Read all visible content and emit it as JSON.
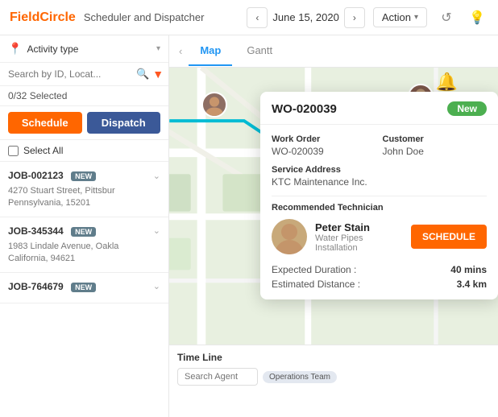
{
  "header": {
    "logo_brand": "Field",
    "logo_accent": "Circle",
    "title": "Scheduler and Dispatcher",
    "date": "June 15, 2020",
    "action_label": "Action",
    "refresh_icon": "↺",
    "bulb_icon": "💡"
  },
  "sidebar": {
    "activity_type_label": "Activity type",
    "search_placeholder": "Search by ID, Locat...",
    "selected_count": "0/32 Selected",
    "schedule_btn": "Schedule",
    "dispatch_btn": "Dispatch",
    "select_all_label": "Select All",
    "jobs": [
      {
        "id": "JOB-002123",
        "badge": "NEW",
        "address": "4270 Stuart Street, Pittsbur",
        "state": "Pennsylvania, 15201"
      },
      {
        "id": "JOB-345344",
        "badge": "NEW",
        "address": "1983 Lindale Avenue, Oakla",
        "state": "California, 94621"
      },
      {
        "id": "JOB-764679",
        "badge": "NEW",
        "address": "",
        "state": ""
      }
    ]
  },
  "tabs": [
    {
      "label": "Map",
      "active": true
    },
    {
      "label": "Gantt",
      "active": false
    }
  ],
  "timeline": {
    "title": "Time Line",
    "search_placeholder": "Search Agent",
    "ops_tag": "Operations Team"
  },
  "popup": {
    "wo_id": "WO-020039",
    "badge": "New",
    "work_order_label": "Work Order",
    "work_order_value": "WO-020039",
    "customer_label": "Customer",
    "customer_value": "John Doe",
    "service_address_label": "Service Address",
    "service_address_value": "KTC Maintenance Inc.",
    "rec_tech_label": "Recommended Technician",
    "tech_name": "Peter Stain",
    "tech_role": "Water Pipes Installation",
    "schedule_btn": "SCHEDULE",
    "expected_duration_label": "Expected Duration :",
    "expected_duration_value": "40 mins",
    "estimated_distance_label": "Estimated Distance :",
    "estimated_distance_value": "3.4 km"
  },
  "colors": {
    "orange": "#ff6600",
    "blue_dark": "#3b5998",
    "blue": "#2196f3",
    "green": "#4caf50",
    "red": "#f44336"
  }
}
